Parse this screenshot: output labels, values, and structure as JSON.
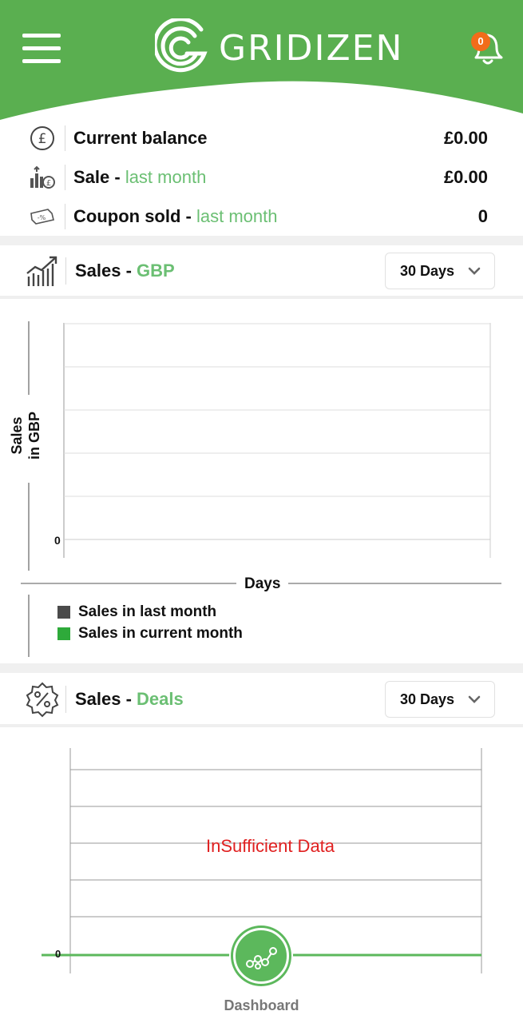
{
  "header": {
    "brand": "GRIDIZEN",
    "notification_count": "0",
    "brand_color": "#5aaf50"
  },
  "stats": [
    {
      "label": "Current balance",
      "accent": "",
      "value": "£0.00",
      "icon": "pound-circle-icon"
    },
    {
      "label": "Sale - ",
      "accent": "last month",
      "value": "£0.00",
      "icon": "sales-bars-icon"
    },
    {
      "label": "Coupon sold - ",
      "accent": "last month",
      "value": "0",
      "icon": "coupon-icon"
    }
  ],
  "sales_gbp": {
    "title": "Sales - ",
    "accent": "GBP",
    "range": "30 Days",
    "icon": "growth-chart-icon"
  },
  "chart_data": {
    "type": "line",
    "ylabel": "Sales\nin GBP",
    "xlabel": "Days",
    "y_ticks": [
      "0"
    ],
    "series": [
      {
        "name": "Sales in last month",
        "color": "#4a4a4a",
        "values": []
      },
      {
        "name": "Sales in current month",
        "color": "#2eaa3a",
        "values": []
      }
    ],
    "grid": true
  },
  "sales_deals": {
    "title": "Sales - ",
    "accent": "Deals",
    "range": "30 Days",
    "icon": "discount-badge-icon",
    "message": "InSufficient Data",
    "zero": "0"
  },
  "bottom_nav": {
    "label": "Dashboard",
    "icon": "dashboard-graph-icon"
  }
}
